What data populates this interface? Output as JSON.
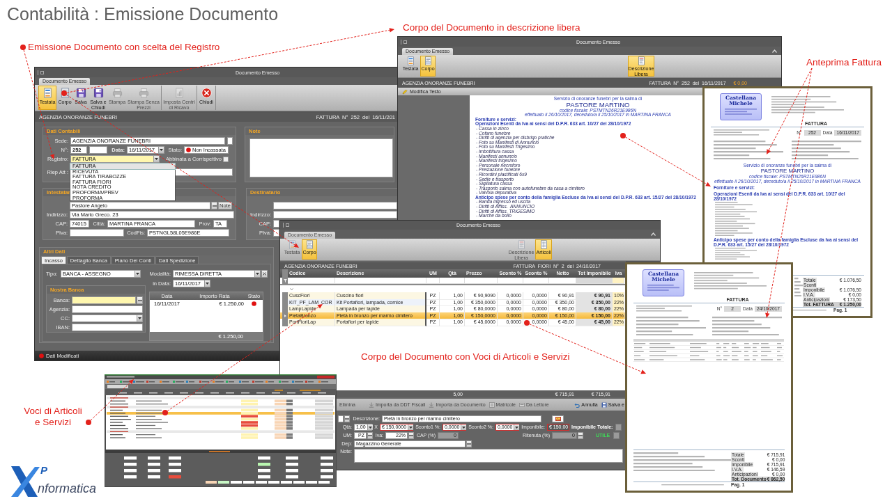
{
  "title": "Contabilità : Emissione Documento",
  "callouts": [
    {
      "text": "Emissione Documento con scelta del Registro"
    },
    {
      "text": "Corpo del Documento in descrizione libera"
    },
    {
      "text": "Anteprima Fattura"
    },
    {
      "text": "Corpo del Documento con Voci di Articoli e Servizi"
    },
    {
      "text": "Voci di Articoli e Servizi"
    }
  ],
  "testata_window": {
    "title": "Documento Emesso",
    "tab": {
      "label": "Documento Emesso",
      "disabled": false
    },
    "ribbon": [
      [
        {
          "label": "Testata",
          "kind": "header",
          "selected": true,
          "disabled": false
        },
        {
          "label": "Corpo",
          "kind": "body",
          "selected": false,
          "disabled": false
        },
        {
          "label": "Salva",
          "kind": "save",
          "selected": false,
          "disabled": false
        },
        {
          "label": "Salva e Chiudi",
          "kind": "save",
          "selected": false,
          "disabled": false
        },
        {
          "label": "Stampa",
          "kind": "print",
          "selected": false,
          "disabled": true
        },
        {
          "label": "Stampa Senza Prezzi",
          "kind": "print",
          "selected": false,
          "disabled": true
        }
      ],
      [
        {
          "label": "Imposta Centri di Ricavo",
          "kind": "cost",
          "selected": false,
          "disabled": true
        }
      ],
      [
        {
          "label": "Chiudi",
          "kind": "close",
          "selected": false,
          "disabled": false
        }
      ]
    ],
    "company": "AGENZIA ONORANZE FUNEBRI",
    "document": "FATTURA N° 252 del 16/11/201",
    "panels": [
      {
        "title": "Dati Contabili",
        "rows": [
          {
            "fields": [
              {
                "kind": "label",
                "text": "Sede:"
              },
              {
                "kind": "input",
                "value": "AGENZIA ONORANZE FUNEBRI",
                "highlighted": false
              },
              {
                "kind": "input",
                "highlighted": false
              }
            ]
          },
          {
            "fields": [
              {
                "kind": "label",
                "text": "N°:"
              },
              {
                "kind": "input",
                "value": "252",
                "highlighted": false
              },
              {
                "kind": "input",
                "highlighted": false
              },
              {
                "kind": "label",
                "text": "Data:"
              },
              {
                "kind": "combo",
                "value": "16/11/2017",
                "highlighted": false
              },
              {
                "kind": "label",
                "text": "Stato:"
              },
              {
                "kind": "status",
                "value": "Non Incassata"
              }
            ]
          },
          {
            "fields": [
              {
                "kind": "label",
                "text": "Registro:"
              },
              {
                "kind": "combo",
                "value": "FATTURA",
                "highlighted": true,
                "options": [
                  {
                    "label": "FATTURA",
                    "selected": true
                  },
                  {
                    "label": "RICEVUTA",
                    "selected": false
                  },
                  {
                    "label": "FATTURA TIRABOZZE",
                    "selected": false
                  },
                  {
                    "label": "FATTURA FIORI",
                    "selected": false
                  },
                  {
                    "label": "NOTA CREDITO",
                    "selected": false
                  },
                  {
                    "label": "PROFORMA/PREV",
                    "selected": false
                  },
                  {
                    "label": "PROFORMA",
                    "selected": false
                  }
                ]
              },
              {
                "kind": "check",
                "text": "Abbinata a Corrispettivo",
                "checked": false
              }
            ]
          },
          {
            "fields": [
              {
                "kind": "label",
                "text": "Riep Att :"
              },
              {
                "kind": "input",
                "highlighted": false
              }
            ]
          }
        ]
      },
      {
        "title": "Note",
        "rows": [
          {
            "fields": [
              {
                "kind": "textarea"
              }
            ]
          }
        ]
      },
      {
        "title": "Intestatar",
        "rows": [
          {
            "fields": [
              {
                "kind": "spacer"
              },
              {
                "kind": "input",
                "value": "Pastore Angelo",
                "highlighted": false
              },
              {
                "kind": "browse"
              },
              {
                "kind": "button",
                "label": "Note"
              }
            ]
          },
          {
            "fields": [
              {
                "kind": "label",
                "text": "Indirizzo:"
              },
              {
                "kind": "input",
                "value": "Via Mario Greco. 23",
                "highlighted": false
              }
            ]
          },
          {
            "fields": [
              {
                "kind": "label",
                "text": "CAP:"
              },
              {
                "kind": "input",
                "value": "74015",
                "highlighted": false
              },
              {
                "kind": "label",
                "text": "Città:"
              },
              {
                "kind": "input",
                "value": "MARTINA FRANCA",
                "highlighted": false
              },
              {
                "kind": "label",
                "text": "Prov:"
              },
              {
                "kind": "input",
                "value": "TA",
                "highlighted": false
              }
            ]
          },
          {
            "fields": [
              {
                "kind": "label",
                "text": "PIva:"
              },
              {
                "kind": "input",
                "highlighted": false
              },
              {
                "kind": "label",
                "text": "CodFis:"
              },
              {
                "kind": "input",
                "value": "PSTNGL58L05E986E",
                "highlighted": false
              }
            ]
          }
        ]
      },
      {
        "title": "Destinatario",
        "rows": [
          {
            "fields": [
              {
                "kind": "spacer"
              },
              {
                "kind": "input",
                "highlighted": false
              }
            ]
          },
          {
            "fields": [
              {
                "kind": "label",
                "text": "Indirizzo:"
              },
              {
                "kind": "input",
                "highlighted": false
              }
            ]
          },
          {
            "fields": [
              {
                "kind": "label",
                "text": "CAP:"
              },
              {
                "kind": "input",
                "highlighted": false
              }
            ]
          },
          {
            "fields": [
              {
                "kind": "label",
                "text": "PIva:"
              },
              {
                "kind": "input",
                "highlighted": false
              }
            ]
          }
        ]
      }
    ],
    "altri_dati": {
      "title": "Altri Dati",
      "tabs": [
        {
          "label": "Incasso",
          "selected": true
        },
        {
          "label": "Dettaglio Banca",
          "selected": false
        },
        {
          "label": "Piano Dei Conti",
          "selected": false
        },
        {
          "label": "Dati Spedizione",
          "selected": false
        }
      ],
      "left_rows": [
        {
          "fields": [
            {
              "kind": "label",
              "text": "Tipo:"
            },
            {
              "kind": "combo",
              "value": "BANCA - ASSEGNO",
              "highlighted": false
            }
          ]
        }
      ],
      "bank": {
        "title": "Nostra Banca",
        "rows": [
          {
            "fields": [
              {
                "kind": "label",
                "text": "Banca:"
              },
              {
                "kind": "input",
                "highlighted": true
              },
              {
                "kind": "browse"
              }
            ]
          },
          {
            "fields": [
              {
                "kind": "label",
                "text": "Agenzia:"
              },
              {
                "kind": "input",
                "highlighted": false
              }
            ]
          },
          {
            "fields": [
              {
                "kind": "label",
                "text": "CC:"
              },
              {
                "kind": "combo",
                "highlighted": false
              }
            ]
          },
          {
            "fields": [
              {
                "kind": "label",
                "text": "IBAN:"
              },
              {
                "kind": "input",
                "highlighted": false
              }
            ]
          }
        ]
      },
      "right_rows": [
        {
          "fields": [
            {
              "kind": "label",
              "text": "Modalità:"
            },
            {
              "kind": "combo",
              "value": "RIMESSA DIRETTA",
              "highlighted": false
            },
            {
              "kind": "clear"
            }
          ]
        },
        {
          "fields": [
            {
              "kind": "label",
              "text": "in Data:"
            },
            {
              "kind": "combo",
              "value": "16/11/2017",
              "highlighted": false
            }
          ]
        }
      ],
      "installments": {
        "columns": [
          "Data",
          "Importo Rata",
          "Stato"
        ],
        "rows": [
          {
            "date": "16/11/2017",
            "amount": "€ 1.250,00",
            "paid": false
          }
        ],
        "total": "€ 1.250,00"
      }
    },
    "status": {
      "text": "Dati Modificati",
      "modified": true
    }
  },
  "descrizione_window": {
    "title": "Documento Emesso",
    "tab": {
      "label": "Documento Emesso",
      "disabled": false
    },
    "ribbon": [
      [
        {
          "label": "Testata",
          "kind": "header",
          "selected": false,
          "disabled": false
        },
        {
          "label": "Corpo",
          "kind": "body",
          "selected": true,
          "disabled": false
        }
      ],
      [
        {
          "label": "Descrizione Libera",
          "kind": "libera",
          "selected": true,
          "disabled": false
        }
      ]
    ],
    "company": "AGENZIA ONORANZE FUNEBRI",
    "document": "FATTURA N° 252 del 16/11/2017",
    "amount": "€ 0,00",
    "editor_bar": "Modifica Testo",
    "page": [
      {
        "kind": "intro",
        "text": "Servizio di onoranze funebri per la salma di"
      },
      {
        "kind": "name",
        "text": "PASTORE MARTINO"
      },
      {
        "kind": "detail",
        "text": "codice fiscale: PSTMTN26R21E986N"
      },
      {
        "kind": "detail",
        "text": "effettuato il 26/10/2017, deceduto/a il 25/10/2017 in MARTINA FRANCA"
      },
      {
        "kind": "heading",
        "text": "Forniture e servizi:"
      },
      {
        "kind": "section",
        "text": "Operazioni Esenti da Iva ai sensi del D.P.R. 633 art. 10/27 del 28/10/1972"
      },
      {
        "kind": "item",
        "text": "- Cassa in zinco"
      },
      {
        "kind": "item",
        "text": "- Cofano funebre"
      },
      {
        "kind": "item",
        "text": "- Diritti di agenzia per disbrigo pratiche"
      },
      {
        "kind": "item",
        "text": "- Foto su Manifesti di Annuncio"
      },
      {
        "kind": "item",
        "text": "- Foto su Manifesti Trigesimo"
      },
      {
        "kind": "item",
        "text": "- Imbottitura cassa"
      },
      {
        "kind": "item",
        "text": "- Manifesti annuncio"
      },
      {
        "kind": "item",
        "text": "- Manifesti trigesimo"
      },
      {
        "kind": "item",
        "text": "- Personale necroforo"
      },
      {
        "kind": "item",
        "text": "- Prestazione funebre"
      },
      {
        "kind": "item",
        "text": "- Ricordini plastificati 6x9"
      },
      {
        "kind": "item",
        "text": "- Sedie e trasporto"
      },
      {
        "kind": "item",
        "text": "- Sigillatura cassa"
      },
      {
        "kind": "item",
        "text": "- Trasporto salma con autofunebre da casa a cimitero"
      },
      {
        "kind": "item",
        "text": "- Valvola depurativa"
      },
      {
        "kind": "section",
        "text": "Anticipo spese per conto della famiglia Escluse da Iva ai sensi del D.P.R. 633 art. 15/27 del 28/10/1972"
      },
      {
        "kind": "item",
        "text": "- Banda ingresso ed uscita"
      },
      {
        "kind": "item",
        "text": "- Diritti di Affiss.  ANNUNCIO"
      },
      {
        "kind": "item",
        "text": "- Diritti di Affiss. TRIGESIMO"
      },
      {
        "kind": "item",
        "text": "- Marche da bollo"
      }
    ]
  },
  "articoli_window": {
    "title": "Documento Emesso",
    "tab": {
      "label": "Documento Emesso",
      "disabled": true
    },
    "ribbon": [
      [
        {
          "label": "Testata",
          "kind": "header",
          "selected": false,
          "disabled": true
        },
        {
          "label": "Corpo",
          "kind": "body",
          "selected": true,
          "disabled": false
        }
      ],
      [
        {
          "label": "Descrizione Libera",
          "kind": "libera",
          "selected": false,
          "disabled": true
        },
        {
          "label": "Articoli",
          "kind": "articoli",
          "selected": true,
          "disabled": false
        }
      ]
    ],
    "company": "AGENZIA ONORANZE FUNEBRI",
    "document": "FATTURA FIORI N° 2 del 24/10/2017",
    "grid": {
      "columns": [
        "Codice",
        "Descrizione",
        "UM",
        "Qtà",
        "Prezzo",
        "Sconto %",
        "Sconto %",
        "Netto",
        "Tot Imponibile",
        "Iva"
      ],
      "rows": [
        {
          "selected": false,
          "cells": [
            "CuscFiori",
            "Cuscino fiori",
            "PZ",
            "1,00",
            "€ 90,9090",
            "0,0000",
            "0,0000",
            "€ 90,91",
            "€ 90,91",
            "10%"
          ]
        },
        {
          "selected": false,
          "cells": [
            "KIT_PF_LAM_COR",
            "Kit Portafiori, lampada, cornice",
            "PZ",
            "1,00",
            "€ 350,0000",
            "0,0000",
            "0,0000",
            "€ 350,00",
            "€ 350,00",
            "22%"
          ]
        },
        {
          "selected": false,
          "cells": [
            "LampLapide",
            "Lampada per lapide",
            "PZ",
            "1,00",
            "€ 80,0000",
            "0,0000",
            "0,0000",
            "€ 80,00",
            "€ 80,00",
            "22%"
          ]
        },
        {
          "selected": true,
          "cells": [
            "PietaBronzo",
            "Pietà in bronzo per marmo cimitero",
            "PZ",
            "1,00",
            "€ 150,0000",
            "0,0000",
            "0,0000",
            "€ 150,00",
            "€ 150,00",
            "22%"
          ]
        },
        {
          "selected": false,
          "cells": [
            "PortFioriLap",
            "Portafiori per lapide",
            "PZ",
            "1,00",
            "€ 45,0000",
            "0,0000",
            "0,0000",
            "€ 45,00",
            "€ 45,00",
            "22%"
          ]
        }
      ]
    },
    "totals": {
      "quantity": "5,00",
      "net": "€ 715,91",
      "taxable": "€ 715,91"
    },
    "toolbar": [
      [
        {
          "label": "Elimina",
          "kind": "text",
          "disabled": true
        },
        {
          "label": "Importa da DDT Fiscali",
          "kind": "import",
          "disabled": true
        },
        {
          "label": "Importa da Documento",
          "kind": "import",
          "disabled": true
        },
        {
          "label": "Matricole",
          "kind": "list",
          "disabled": true
        },
        {
          "label": "Da Lettore",
          "kind": "reader",
          "disabled": true
        }
      ],
      [
        {
          "label": "Annulla",
          "kind": "undo",
          "disabled": false
        },
        {
          "label": "Salva e",
          "kind": "save",
          "disabled": false
        }
      ]
    ],
    "form": [
      {
        "fields": [
          {
            "kind": "input",
            "flagged": false
          },
          {
            "kind": "browse"
          },
          {
            "kind": "label",
            "text": "Descrizione:"
          },
          {
            "kind": "input",
            "value": "Pietà in bronzo per marmo cimitero",
            "flagged": false
          },
          {
            "kind": "picker"
          }
        ]
      },
      {
        "fields": [
          {
            "kind": "label",
            "text": "Qtà:"
          },
          {
            "kind": "combo",
            "value": "1,00",
            "flagged": false
          },
          {
            "kind": "label",
            "text": "X"
          },
          {
            "kind": "combo",
            "value": "€ 150,0000",
            "flagged": true
          },
          {
            "kind": "label",
            "text": "Sconto1 %:"
          },
          {
            "kind": "combo",
            "value": "0,0000",
            "flagged": true
          },
          {
            "kind": "label",
            "text": "Sconto2 %:"
          },
          {
            "kind": "combo",
            "value": "0,0000",
            "flagged": true
          },
          {
            "kind": "label",
            "text": "Imponibile:"
          },
          {
            "kind": "readonly",
            "value": "€ 150,00",
            "flagged": true
          },
          {
            "kind": "strong",
            "text": "Imponibile Totale:"
          },
          {
            "kind": "readonly",
            "flagged": false
          }
        ]
      },
      {
        "fields": [
          {
            "kind": "label",
            "text": "UM:"
          },
          {
            "kind": "input",
            "value": "PZ",
            "flagged": false
          },
          {
            "kind": "browse"
          },
          {
            "kind": "label",
            "text": "Iva:"
          },
          {
            "kind": "input",
            "value": "22%",
            "flagged": false
          },
          {
            "kind": "browse"
          },
          {
            "kind": "label",
            "text": "CAP (%)"
          },
          {
            "kind": "readonly",
            "value": "0",
            "flagged": false
          },
          {
            "kind": "label",
            "text": "Ritenuta (%)"
          },
          {
            "kind": "readonly",
            "value": "0",
            "flagged": false
          },
          {
            "kind": "browse"
          },
          {
            "kind": "indicator",
            "text": "UTILE"
          },
          {
            "kind": "readonly",
            "flagged": false
          }
        ]
      },
      {
        "fields": [
          {
            "kind": "label",
            "text": "Dep:"
          },
          {
            "kind": "input",
            "value": "Magazzino Generale",
            "flagged": false
          },
          {
            "kind": "browse"
          }
        ]
      },
      {
        "fields": [
          {
            "kind": "label",
            "text": "Note:"
          },
          {
            "kind": "textarea"
          }
        ]
      }
    ]
  },
  "invoice_previews": [
    {
      "kind": "text",
      "logo": "Castellana Michele",
      "title": "FATTURA",
      "number_label": "N°",
      "number": "252",
      "date_label": "Data",
      "date": "16/11/2017",
      "body": [
        {
          "kind": "intro",
          "text": "Servizio di onoranze funebri per la salma di"
        },
        {
          "kind": "name",
          "text": "PASTORE MARTINO"
        },
        {
          "kind": "detail",
          "text": "codice fiscale: PSTMTN26R21E986N"
        },
        {
          "kind": "detail",
          "text": "effettuato il 26/10/2017, deceduto/a il 25/10/2017 in MARTINA FRANCA"
        },
        {
          "kind": "heading",
          "text": "Forniture e servizi:"
        },
        {
          "kind": "section",
          "text": "Operazioni Esenti da Iva ai sensi del D.P.R. 633 art. 10/27 del 28/10/1972"
        },
        {
          "kind": "section",
          "text": "Anticipo spese per conto della famiglia Escluse da Iva ai sensi del D.P.R. 633 art. 15/27 del 28/10/1972"
        }
      ],
      "totals": [
        {
          "label": "Totale",
          "value": "€ 1.076,50"
        },
        {
          "label": "Sconti"
        },
        {
          "label": "Imponibile",
          "value": "€ 1.076,50"
        },
        {
          "label": "I.V.A.",
          "value": "€ 0,00"
        },
        {
          "label": "Anticipazioni",
          "value": "€ 173,50"
        },
        {
          "label": "Tot. FATTURA",
          "value": "€ 1.250,00"
        }
      ],
      "page": "Pag. 1"
    },
    {
      "kind": "table",
      "logo": "Castellana Michele",
      "title": "FATTURA",
      "number_label": "N°",
      "number": "2",
      "date_label": "Data",
      "date": "24/10/2017",
      "totals": [
        {
          "label": "Totale",
          "value": "€ 715,91"
        },
        {
          "label": "Sconti",
          "value": "€ 0,00"
        },
        {
          "label": "Imponibile",
          "value": "€ 715,91"
        },
        {
          "label": "I.V.A.",
          "value": "€ 146,59"
        },
        {
          "label": "Anticipazioni",
          "value": "€ 0,00"
        },
        {
          "label": "Tot. Documento",
          "value": "€ 862,50"
        }
      ],
      "page": "Pag. 1"
    }
  ],
  "logo": {
    "mark": "P",
    "text": "nformatica"
  }
}
